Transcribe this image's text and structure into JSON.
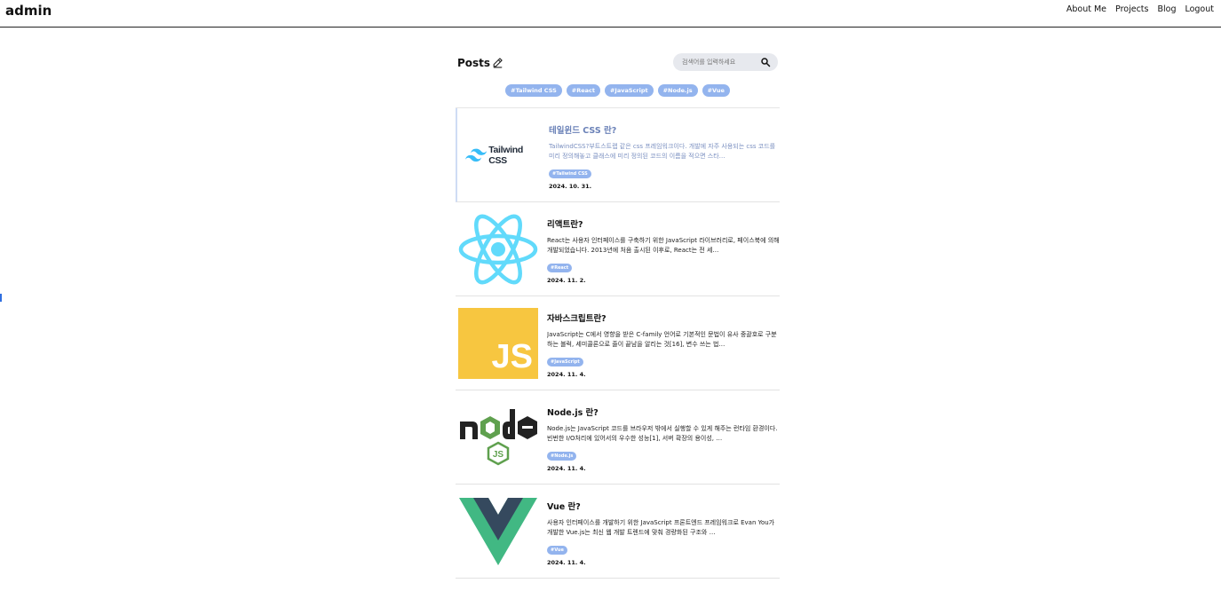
{
  "header": {
    "brand": "admin",
    "nav": [
      "About Me",
      "Projects",
      "Blog",
      "Logout"
    ]
  },
  "posts_header": {
    "title": "Posts",
    "search_placeholder": "검색어를 입력하세요"
  },
  "tags": [
    "#Tailwind CSS",
    "#React",
    "#JavaScript",
    "#Node.js",
    "#Vue"
  ],
  "posts": [
    {
      "title": "테일윈드 CSS 란?",
      "summary": "TailwindCSS?부트스트랩 같은 css 프레임워크이다. 개발에 자주 사용되는 css 코드를 미리 정의해놓고 클래스에 미리 정의된 코드의 이름을 적으면 스타…",
      "tag": "#Tailwind CSS",
      "date": "2024. 10. 31.",
      "thumb_text": "Tailwind CSS"
    },
    {
      "title": "리액트란?",
      "summary": "React는 사용자 인터페이스를 구축하기 위한 JavaScript 라이브러리로, 페이스북에 의해 개발되었습니다. 2013년에 처음 출시된 이후로, React는 전 세…",
      "tag": "#React",
      "date": "2024. 11. 2."
    },
    {
      "title": "자바스크립트란?",
      "summary": "JavaScript는 C에서 영향을 받은 C-family 언어로 기본적인 문법이 유사 중괄호로 구분하는 블럭, 세미콜론으로 줄이 끝남을 알리는 것[16], 변수 쓰는 법…",
      "tag": "#JavaScript",
      "date": "2024. 11. 4.",
      "thumb_text": "JS"
    },
    {
      "title": "Node.js 란?",
      "summary": "Node.js는 JavaScript 코드를 브라우저 밖에서 실행할 수 있게 해주는 런타임 환경이다. 빈번한 I/O처리에 있어서의 우수한 성능[1], 서버 확장의 용이성, …",
      "tag": "#Node.js",
      "date": "2024. 11. 4."
    },
    {
      "title": "Vue 란?",
      "summary": "사용자 인터페이스를 개발하기 위한 JavaScript 프론트엔드 프레임워크로 Evan You가 개발한 Vue.js는 최신 웹 개발 트렌드에 맞춰 경량화된 구조와 …",
      "tag": "#Vue",
      "date": "2024. 11. 4."
    }
  ],
  "colors": {
    "tag_bg": "#93b4ee",
    "react": "#61dafb",
    "js_bg": "#f7c640",
    "node_green": "#5fa04e",
    "vue_green": "#41b883",
    "vue_dark": "#35495e",
    "tailwind": "#38bdf8"
  },
  "icons": [
    "pencil-icon",
    "search-icon",
    "tailwind-logo",
    "react-logo",
    "js-logo",
    "nodejs-logo",
    "vue-logo"
  ]
}
